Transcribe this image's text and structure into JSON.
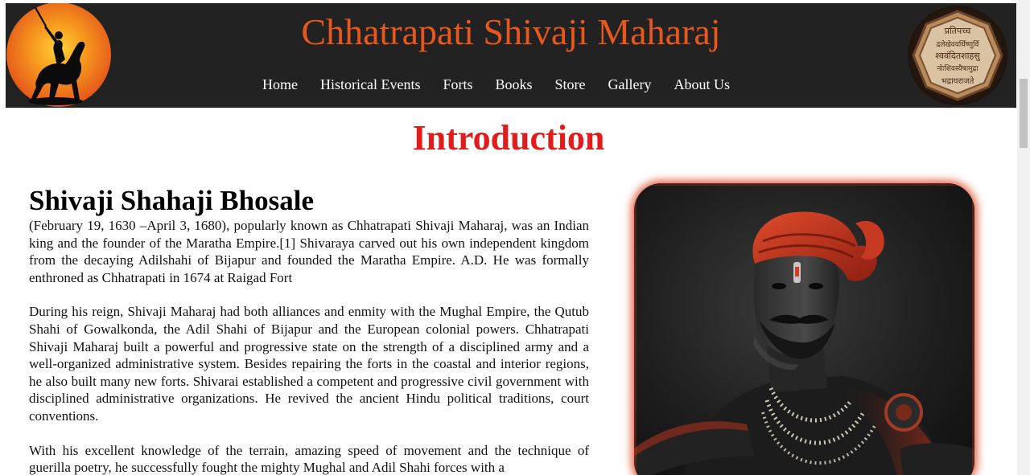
{
  "header": {
    "site_title": "Chhatrapati Shivaji Maharaj",
    "nav": [
      {
        "label": "Home"
      },
      {
        "label": "Historical Events"
      },
      {
        "label": "Forts"
      },
      {
        "label": "Books"
      },
      {
        "label": "Store"
      },
      {
        "label": "Gallery"
      },
      {
        "label": "About Us"
      }
    ],
    "seal_text": [
      "प्रतिपच्च",
      "द्रलेखेववर्धिष्णुर्वि",
      "श्ववंदितशाहसु",
      "नोःशिवस्यैषामुद्रा",
      "भद्रायराजते"
    ]
  },
  "main": {
    "heading": "Introduction",
    "name": "Shivaji Shahaji Bhosale",
    "paragraphs": [
      "(February 19, 1630 –April 3, 1680), popularly known as Chhatrapati Shivaji Maharaj, was an Indian king and the founder of the Maratha Empire.[1] Shivaraya carved out his own independent kingdom from the decaying Adilshahi of Bijapur and founded the Maratha Empire. A.D. He was formally enthroned as Chhatrapati in 1674 at Raigad Fort",
      "During his reign, Shivaji Maharaj had both alliances and enmity with the Mughal Empire, the Qutub Shahi of Gowalkonda, the Adil Shahi of Bijapur and the European colonial powers. Chhatrapati Shivaji Maharaj built a powerful and progressive state on the strength of a disciplined army and a well-organized administrative system. Besides repairing the forts in the coastal and interior regions, he also built many new forts. Shivarai established a competent and progressive civil government with disciplined administrative organizations. He revived the ancient Hindu political traditions, court conventions.",
      "With his excellent knowledge of the terrain, amazing speed of movement and the technique of guerilla poetry, he successfully fought the mighty Mughal and Adil Shahi forces with a"
    ]
  },
  "colors": {
    "header_bg": "#222222",
    "title": "#e8571c",
    "heading": "#e21b1b",
    "glow": "#dc3c14"
  }
}
